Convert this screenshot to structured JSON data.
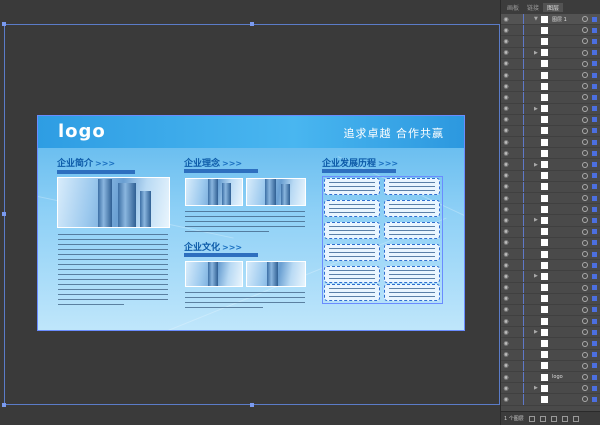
{
  "panel": {
    "tabs": [
      "画板",
      "链接",
      "图层"
    ],
    "active_tab": "图层",
    "top_layer_name": "图层 1",
    "logo_layer_name": "logo",
    "footer_label": "1 个图层",
    "footer_icons": [
      "locate-object-icon",
      "make-clipping-mask-icon",
      "new-sublayer-icon",
      "new-layer-icon",
      "delete-layer-icon"
    ]
  },
  "brochure": {
    "logo": "logo",
    "slogan": "追求卓越 合作共赢",
    "sections": {
      "intro": {
        "title": "企业简介",
        "arrows": ">>>"
      },
      "philosophy": {
        "title": "企业理念",
        "arrows": ">>>"
      },
      "culture": {
        "title": "企业文化",
        "arrows": ">>>"
      },
      "history": {
        "title": "企业发展历程",
        "arrows": ">>>"
      }
    }
  },
  "colors": {
    "canvas_bg": "#3a3a3a",
    "banner": "#2e9de3",
    "selection": "#6a8cff",
    "panel_bg": "#4a4a4a"
  }
}
